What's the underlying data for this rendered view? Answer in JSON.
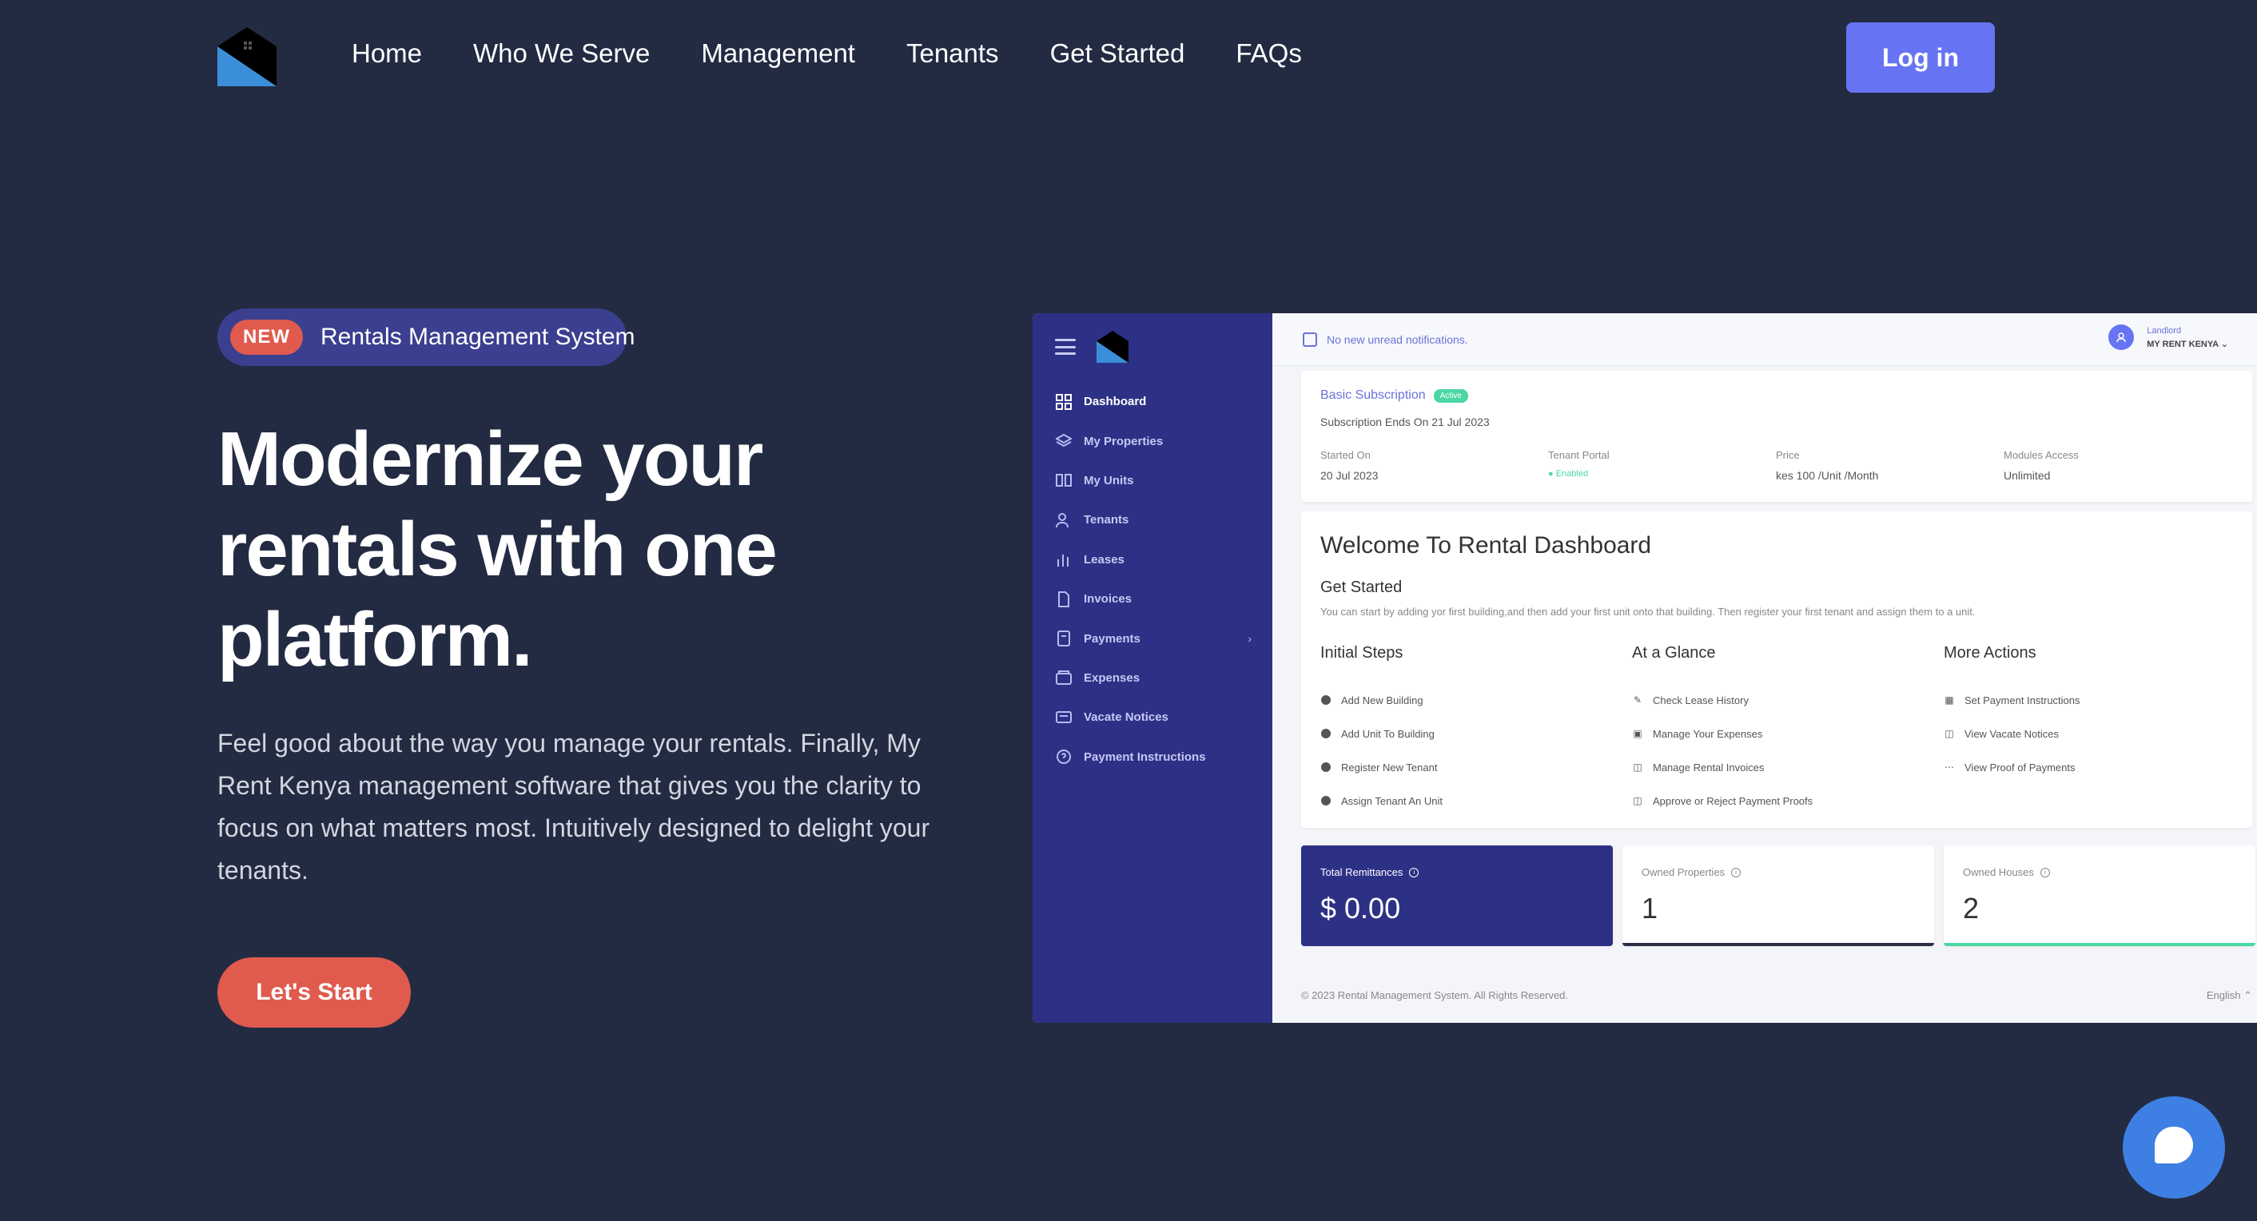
{
  "nav": {
    "links": [
      "Home",
      "Who We Serve",
      "Management",
      "Tenants",
      "Get Started",
      "FAQs"
    ],
    "login": "Log in"
  },
  "hero": {
    "badge_new": "NEW",
    "badge_text": "Rentals Management System",
    "title": "Modernize your rentals with one platform.",
    "description": "Feel good about the way you manage your rentals. Finally, My Rent Kenya management software that gives you the clarity to focus on what matters most. Intuitively designed to delight your tenants.",
    "cta": "Let's Start"
  },
  "dashboard": {
    "sidebar": [
      {
        "label": "Dashboard",
        "icon": "grid-icon"
      },
      {
        "label": "My Properties",
        "icon": "layers-icon"
      },
      {
        "label": "My Units",
        "icon": "columns-icon"
      },
      {
        "label": "Tenants",
        "icon": "users-icon"
      },
      {
        "label": "Leases",
        "icon": "bar-chart-icon"
      },
      {
        "label": "Invoices",
        "icon": "file-icon"
      },
      {
        "label": "Payments",
        "icon": "receipt-icon"
      },
      {
        "label": "Expenses",
        "icon": "wallet-icon"
      },
      {
        "label": "Vacate Notices",
        "icon": "message-icon"
      },
      {
        "label": "Payment Instructions",
        "icon": "help-icon"
      }
    ],
    "notification": "No new unread notifications.",
    "user_role": "Landlord",
    "user_name": "MY RENT KENYA",
    "subscription": {
      "title": "Basic Subscription",
      "status": "Active",
      "ends": "Subscription Ends On 21 Jul 2023",
      "cols": [
        {
          "label": "Started On",
          "value": "20 Jul 2023"
        },
        {
          "label": "Tenant Portal",
          "value": "Enabled"
        },
        {
          "label": "Price",
          "value": "kes 100 /Unit /Month"
        },
        {
          "label": "Modules Access",
          "value": "Unlimited"
        }
      ]
    },
    "welcome": {
      "title": "Welcome To Rental Dashboard",
      "get_started": "Get Started",
      "description": "You can start by adding yor first building,and then add your first unit onto that building. Then register your first tenant and assign them to a unit.",
      "initial_steps": {
        "title": "Initial Steps",
        "items": [
          "Add New Building",
          "Add Unit To Building",
          "Register New Tenant",
          "Assign Tenant An Unit"
        ]
      },
      "at_a_glance": {
        "title": "At a Glance",
        "items": [
          "Check Lease History",
          "Manage Your Expenses",
          "Manage Rental Invoices",
          "Approve or Reject Payment Proofs"
        ]
      },
      "more_actions": {
        "title": "More Actions",
        "items": [
          "Set Payment Instructions",
          "View Vacate Notices",
          "View Proof of Payments"
        ]
      }
    },
    "stats": [
      {
        "label": "Total Remittances",
        "value": "$ 0.00"
      },
      {
        "label": "Owned Properties",
        "value": "1"
      },
      {
        "label": "Owned Houses",
        "value": "2"
      }
    ],
    "footer": "© 2023 Rental Management System. All Rights Reserved.",
    "language": "English ⌃"
  },
  "colors": {
    "background": "#222b42",
    "accent": "#6674f4",
    "cta": "#e05a4e",
    "sidebar": "#2d3185",
    "green": "#4cd6a4"
  }
}
